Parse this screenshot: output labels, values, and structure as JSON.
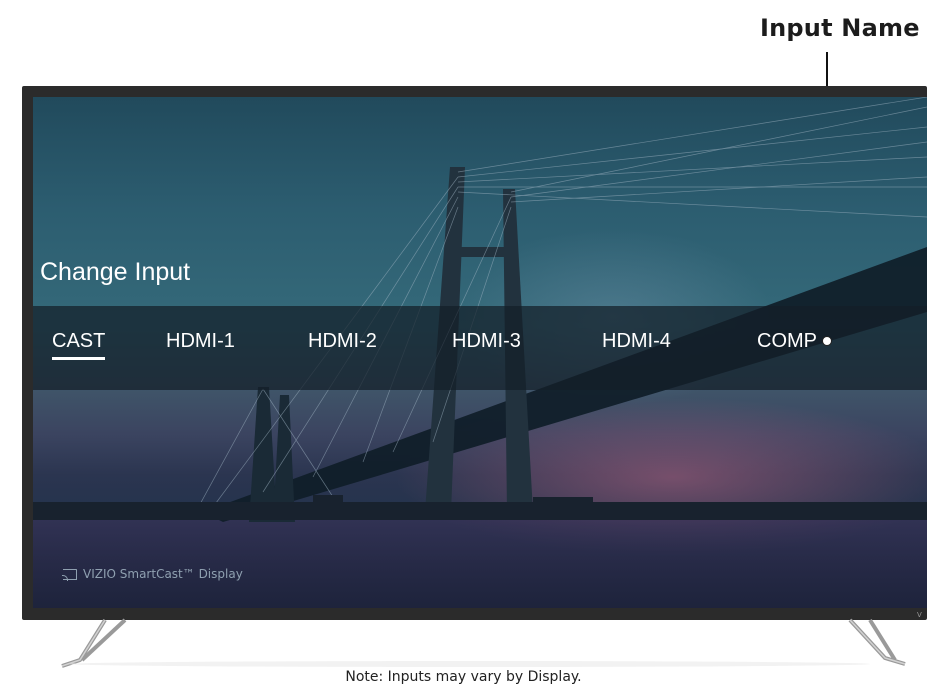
{
  "callout": {
    "label": "Input Name"
  },
  "screen": {
    "title": "Change Input",
    "inputs": [
      {
        "label": "CAST",
        "selected": true
      },
      {
        "label": "HDMI-1",
        "selected": false
      },
      {
        "label": "HDMI-2",
        "selected": false
      },
      {
        "label": "HDMI-3",
        "selected": false
      },
      {
        "label": "HDMI-4",
        "selected": false
      },
      {
        "label": "COMP",
        "selected": false
      }
    ],
    "footer_label": "VIZIO SmartCast™ Display",
    "footer_icon": "cast-icon",
    "brand": "V"
  },
  "note": "Note: Inputs may vary by Display.",
  "colors": {
    "bezel": "#2b2b2b",
    "input_bar": "#141e28",
    "text": "#ffffff"
  }
}
